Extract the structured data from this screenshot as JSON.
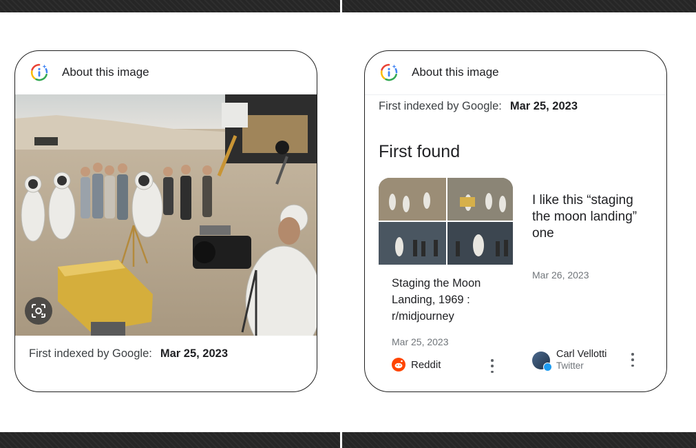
{
  "colors": {
    "frame_bar": "#262626",
    "card_border": "#1f1f1f",
    "text_primary": "#202124",
    "text_secondary": "#70757a",
    "reddit_orange": "#ff4500",
    "twitter_blue": "#1d9bf0"
  },
  "panel_left": {
    "header": {
      "title": "About this image",
      "icon": "google-lens-info-icon"
    },
    "image_search_icon": "lens-camera-icon",
    "indexed": {
      "label": "First indexed by Google:",
      "date": "Mar 25, 2023"
    }
  },
  "panel_right": {
    "header": {
      "title": "About this image",
      "icon": "google-lens-info-icon"
    },
    "indexed": {
      "label": "First indexed by Google:",
      "date": "Mar 25, 2023"
    },
    "section_title": "First found",
    "results": [
      {
        "title": "Staging the Moon Landing, 1969 : r/midjourney",
        "date": "Mar 25, 2023",
        "source": "Reddit",
        "source_icon": "reddit-icon",
        "menu_icon": "more-vert-icon"
      },
      {
        "title": "I like this “staging the moon landing” one",
        "date": "Mar 26, 2023",
        "author": "Carl Vellotti",
        "source": "Twitter",
        "source_icon": "twitter-verified-badge-icon",
        "menu_icon": "more-vert-icon"
      }
    ]
  }
}
